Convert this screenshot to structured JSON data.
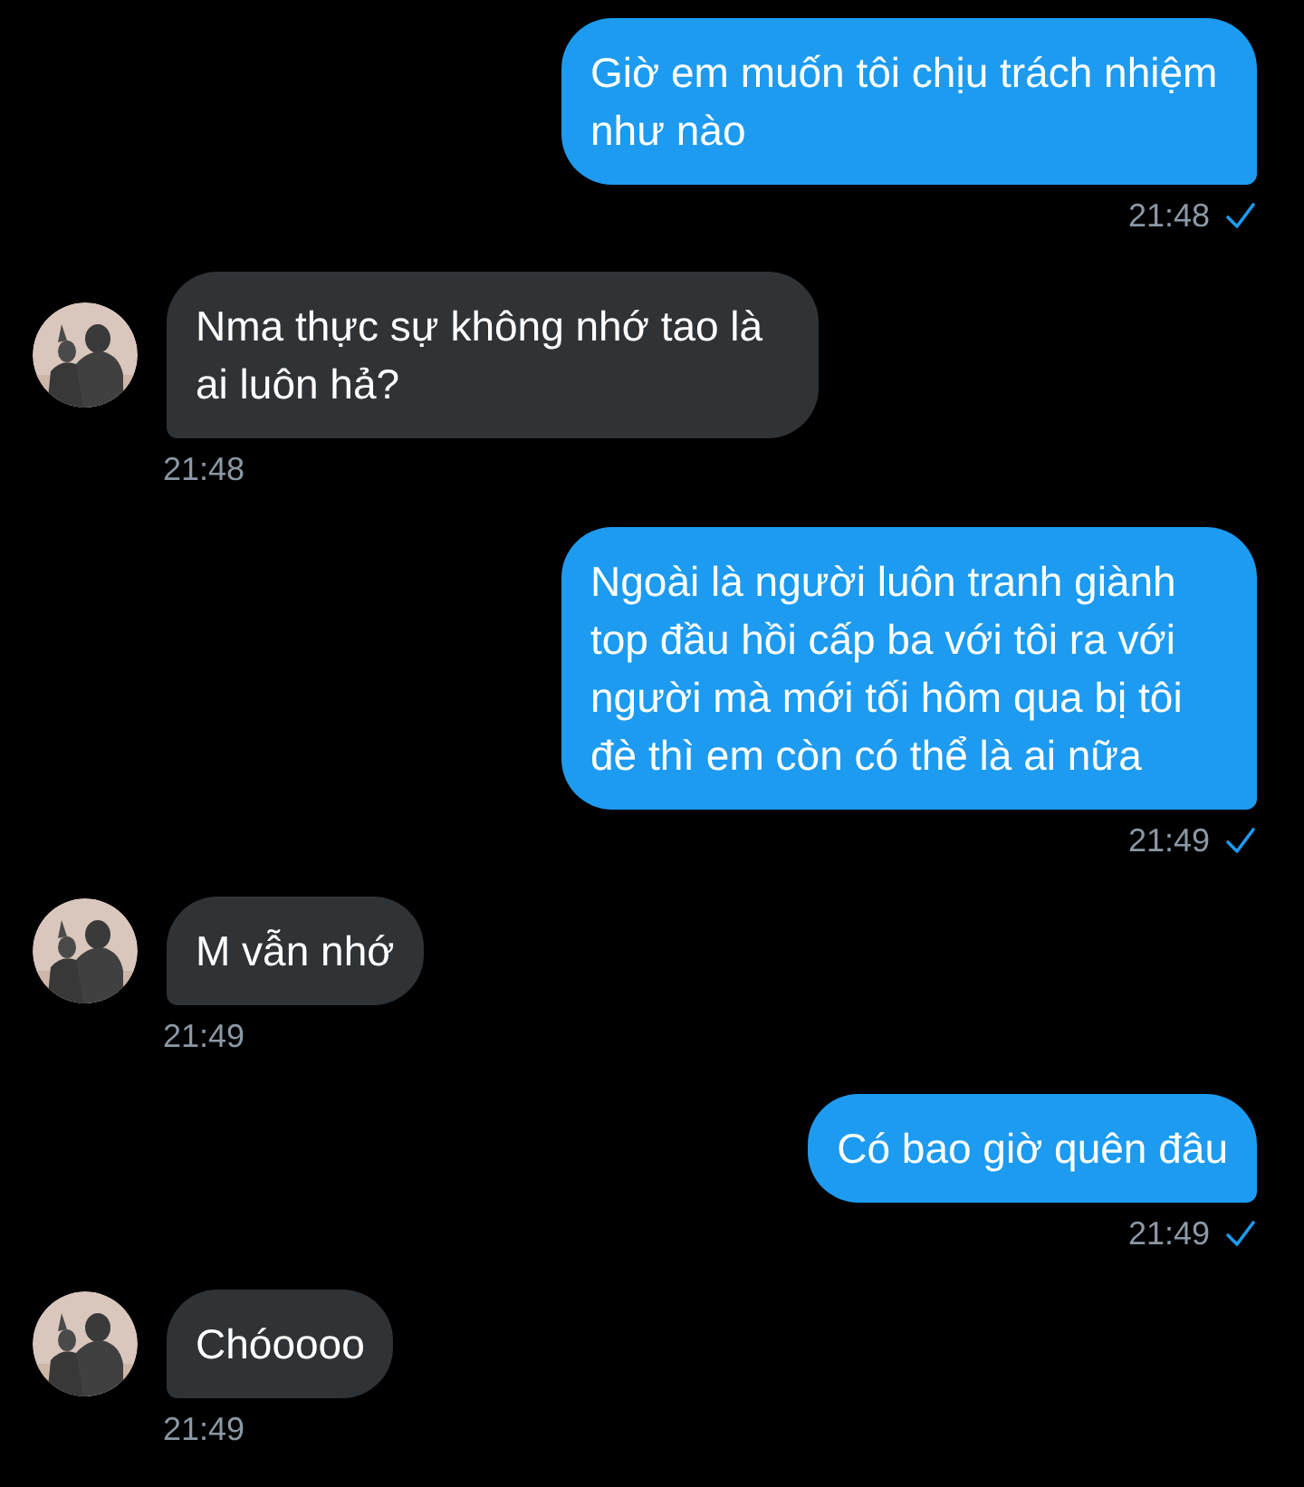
{
  "messages": [
    {
      "kind": "sent",
      "text": "Giờ em muốn tôi chịu trách nhiệm như nào",
      "time": "21:48",
      "delivered": true
    },
    {
      "kind": "received",
      "text": "Nma thực sự không nhớ tao là ai luôn hả?",
      "time": "21:48"
    },
    {
      "kind": "sent",
      "text": "Ngoài là người luôn tranh giành top đầu hồi cấp ba với tôi ra với người mà mới tối hôm qua bị tôi đè thì em còn có thể là ai nữa",
      "time": "21:49",
      "delivered": true
    },
    {
      "kind": "received",
      "text": "M vẫn nhớ",
      "time": "21:49"
    },
    {
      "kind": "sent",
      "text": "Có bao giờ quên đâu",
      "time": "21:49",
      "delivered": true
    },
    {
      "kind": "received",
      "text": "Chóoooo",
      "time": "21:49"
    }
  ]
}
